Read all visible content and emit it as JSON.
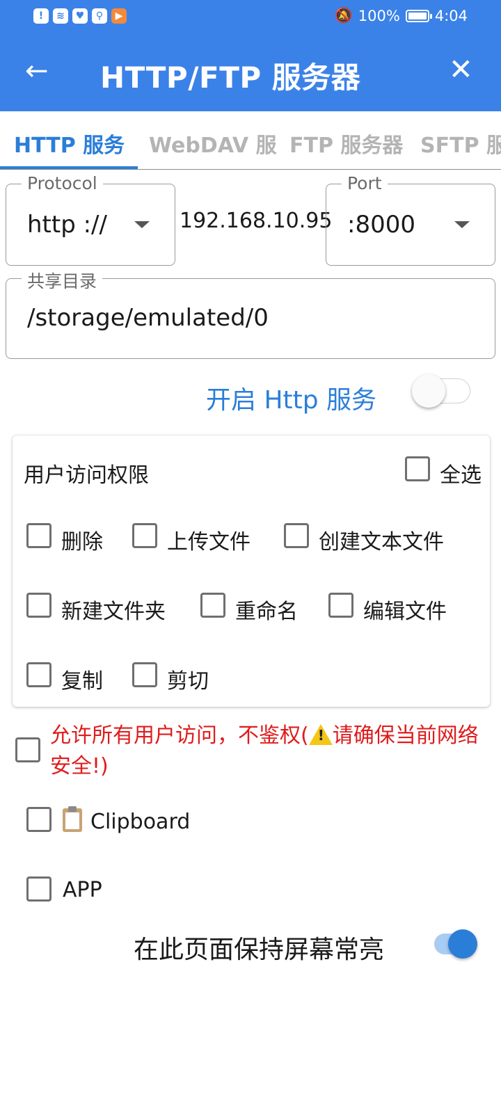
{
  "status_bar": {
    "battery": "100%",
    "time": "4:04",
    "icons": [
      "alert-icon",
      "wifi-icon",
      "health-icon",
      "search-app-icon",
      "video-app-icon",
      "bell-off-icon",
      "battery-icon"
    ]
  },
  "header": {
    "title": "HTTP/FTP 服务器",
    "back_icon": "arrow-left-icon",
    "close_icon": "close-icon"
  },
  "tabs": [
    {
      "label": "HTTP 服务",
      "active": true
    },
    {
      "label": "WebDAV 服",
      "active": false
    },
    {
      "label": "FTP 服务器",
      "active": false
    },
    {
      "label": "SFTP 服",
      "active": false
    }
  ],
  "form": {
    "protocol_label": "Protocol",
    "protocol_value": "http ://",
    "ip": "192.168.10.95",
    "port_label": "Port",
    "port_value": ":8000",
    "share_dir_label": "共享目录",
    "share_dir_value": "/storage/emulated/0"
  },
  "service": {
    "label": "开启 Http 服务",
    "enabled": false
  },
  "permissions": {
    "title": "用户访问权限",
    "select_all": "全选",
    "items": [
      {
        "label": "删除",
        "checked": false
      },
      {
        "label": "上传文件",
        "checked": false
      },
      {
        "label": "创建文本文件",
        "checked": false
      },
      {
        "label": "新建文件夹",
        "checked": false
      },
      {
        "label": "重命名",
        "checked": false
      },
      {
        "label": "编辑文件",
        "checked": false
      },
      {
        "label": "复制",
        "checked": false
      },
      {
        "label": "剪切",
        "checked": false
      }
    ]
  },
  "options": {
    "allow_all_part1": "允许所有用户访问，不鉴权(",
    "allow_all_part2": "请确保当前网络安全!)",
    "clipboard": "Clipboard",
    "clipboard_icon": "clipboard-icon",
    "app": "APP"
  },
  "keep_screen": {
    "label": "在此页面保持屏幕常亮",
    "enabled": true
  },
  "colors": {
    "primary": "#3b82e8",
    "accent": "#2b7ed8",
    "warning": "#e01b1b"
  }
}
